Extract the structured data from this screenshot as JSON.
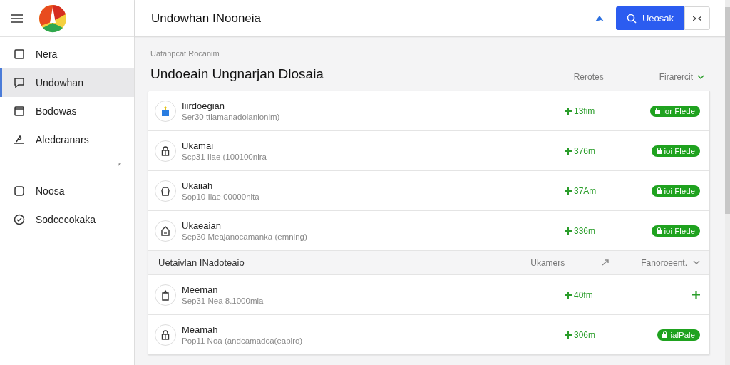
{
  "topbar": {
    "title": "Undowhan INooneia",
    "search_button": "Ueosak"
  },
  "sidebar": {
    "items": [
      {
        "label": "Nera",
        "selected": false
      },
      {
        "label": "Undowhan",
        "selected": true
      },
      {
        "label": "Bodowas",
        "selected": false
      },
      {
        "label": "Aledcranars",
        "selected": false
      },
      {
        "label": "*",
        "kind": "mark"
      },
      {
        "label": "Noosa",
        "selected": false
      },
      {
        "label": "Sodcecokaka",
        "selected": false
      }
    ]
  },
  "content": {
    "breadcrumb": "Uatanpcat Rocanim",
    "heading": "Undoeain Ungnarjan Dlosaia",
    "column_1": "Rerotes",
    "column_2": "Firarercit",
    "groups": [
      {
        "rows": [
          {
            "title": "Iiirdoegian",
            "subtitle": "Ser30 ttiamanadolanionim)",
            "amount": "13fim",
            "kind": "badge",
            "badge": "ior Flede"
          },
          {
            "title": "Ukamai",
            "subtitle": "Scp31 Ilae (100100nira",
            "amount": "376m",
            "kind": "badge",
            "badge": "ioi Flede"
          },
          {
            "title": "Ukaiiah",
            "subtitle": "Sop10 Ilae 00000nita",
            "amount": "37Am",
            "kind": "badge",
            "badge": "ioi Flede"
          },
          {
            "title": "Ukaeaian",
            "subtitle": "Sep30 Meajanocamanka (emning)",
            "amount": "336m",
            "kind": "badge",
            "badge": "ioi Flede"
          }
        ]
      },
      {
        "header": {
          "title": "Uetaivlan INadoteaio",
          "column_1": "Ukamers",
          "column_2": "Fanoroeent."
        },
        "rows": [
          {
            "title": "Meeman",
            "subtitle": "Sep31 Nea 8.1000mia",
            "amount": "40fm",
            "kind": "icon"
          },
          {
            "title": "Meamah",
            "subtitle": "Pop11 Noa (andcamadca(eapiro)",
            "amount": "306m",
            "kind": "badge",
            "badge": "ialPale"
          }
        ]
      }
    ]
  }
}
